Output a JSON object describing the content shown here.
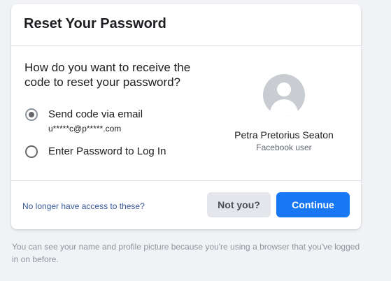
{
  "card": {
    "title": "Reset Your Password",
    "question": "How do you want to receive the code to reset your password?",
    "options": [
      {
        "label": "Send code via email",
        "sub": "u*****c@p*****.com",
        "selected": true
      },
      {
        "label": "Enter Password to Log In",
        "selected": false
      }
    ],
    "profile": {
      "name": "Petra Pretorius Seaton",
      "subtitle": "Facebook user",
      "avatar_icon": "default-user-avatar"
    },
    "footer": {
      "link": "No longer have access to these?",
      "not_you": "Not you?",
      "continue": "Continue"
    }
  },
  "help_text": "You can see your name and profile picture because you're using a browser that you've logged in on before.",
  "colors": {
    "primary": "#1877f2",
    "link": "#385898",
    "secondary_button": "#e4e6eb",
    "background": "#f0f2f5"
  }
}
